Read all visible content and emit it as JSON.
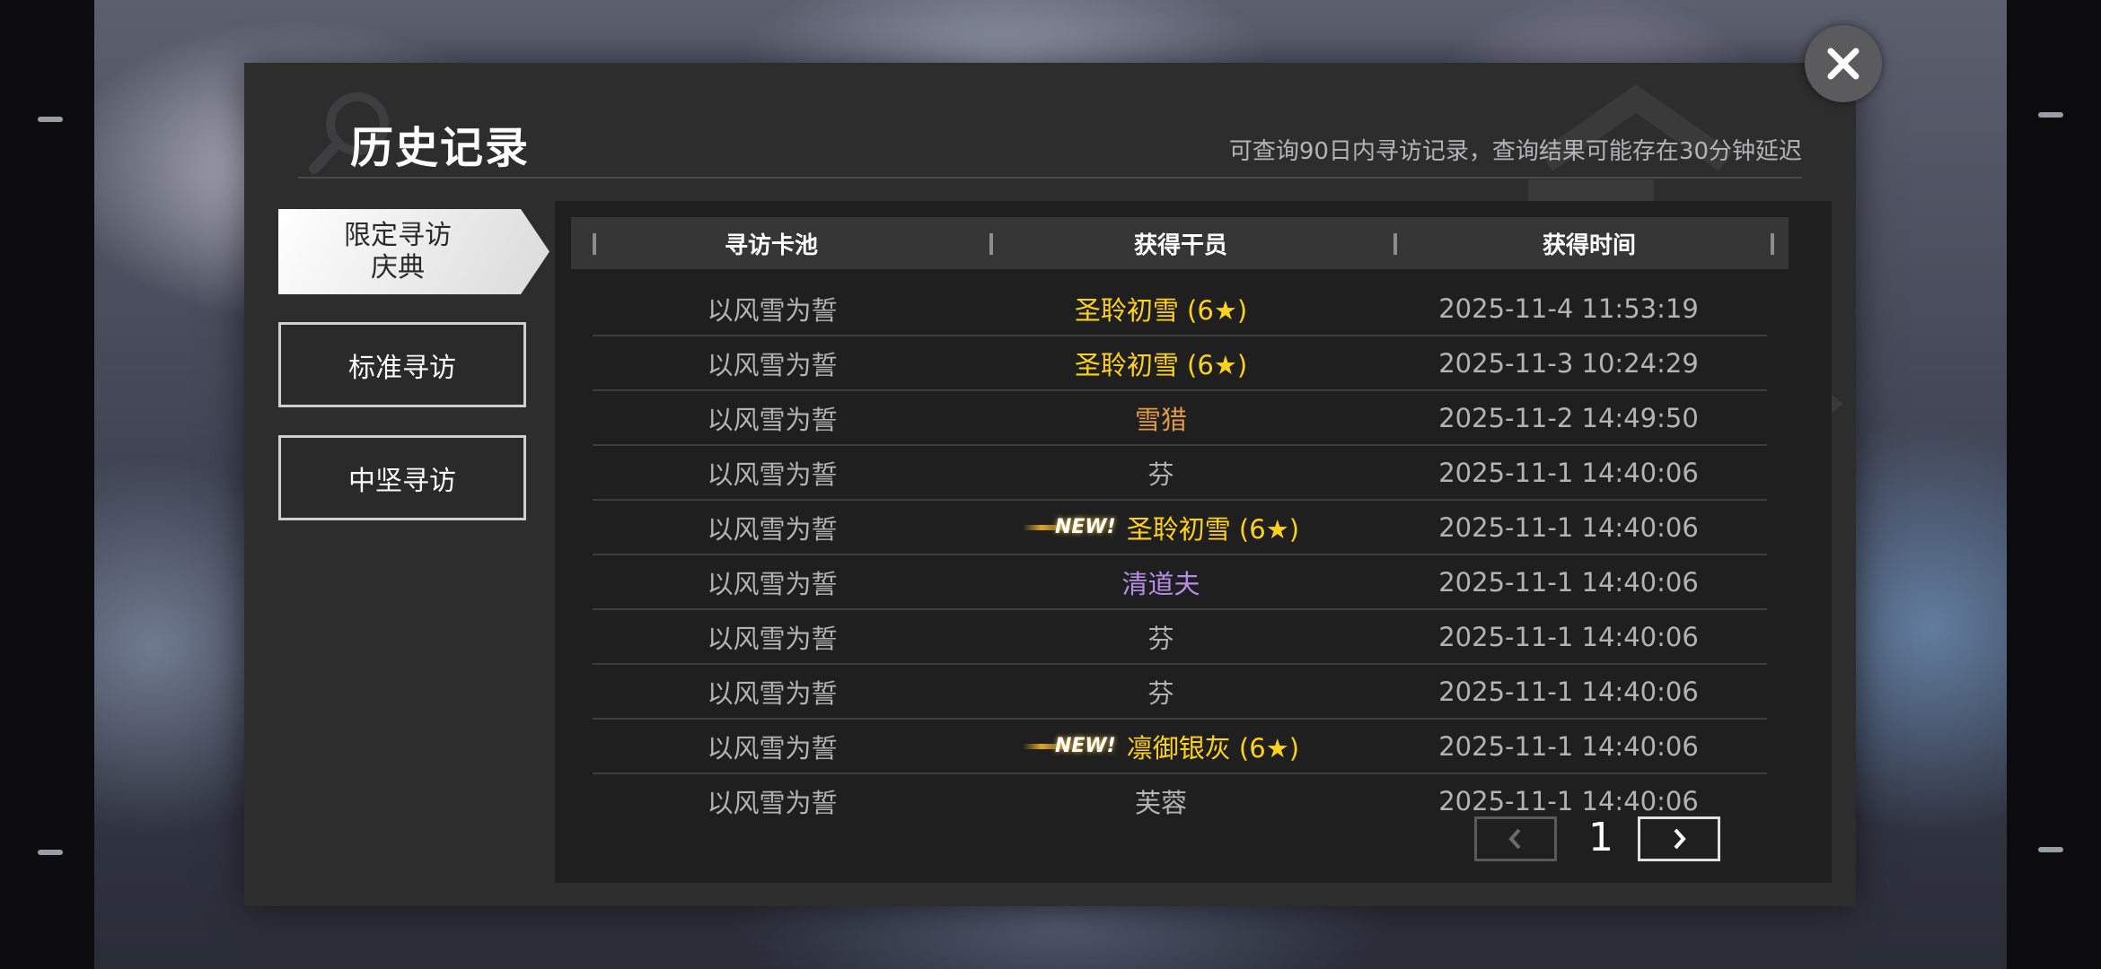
{
  "dialog": {
    "title": "历史记录",
    "subtitle": "可查询90日内寻访记录，查询结果可能存在30分钟延迟"
  },
  "tabs": [
    {
      "line1": "限定寻访",
      "line2": "庆典",
      "active": true
    },
    {
      "label": "标准寻访",
      "active": false
    },
    {
      "label": "中坚寻访",
      "active": false
    }
  ],
  "table": {
    "headers": [
      "寻访卡池",
      "获得干员",
      "获得时间"
    ],
    "rows": [
      {
        "pool": "以风雪为誓",
        "operator": "圣聆初雪 (6★)",
        "time": "2025-11-4 11:53:19",
        "new": false,
        "color": "#ffd21f"
      },
      {
        "pool": "以风雪为誓",
        "operator": "圣聆初雪 (6★)",
        "time": "2025-11-3 10:24:29",
        "new": false,
        "color": "#ffd21f"
      },
      {
        "pool": "以风雪为誓",
        "operator": "雪猎",
        "time": "2025-11-2 14:49:50",
        "new": false,
        "color": "#e39a47"
      },
      {
        "pool": "以风雪为誓",
        "operator": "芬",
        "time": "2025-11-1 14:40:06",
        "new": false,
        "color": "#b3b3b3"
      },
      {
        "pool": "以风雪为誓",
        "operator": "圣聆初雪 (6★)",
        "time": "2025-11-1 14:40:06",
        "new": true,
        "color": "#ffd21f"
      },
      {
        "pool": "以风雪为誓",
        "operator": "清道夫",
        "time": "2025-11-1 14:40:06",
        "new": false,
        "color": "#b58ce6"
      },
      {
        "pool": "以风雪为誓",
        "operator": "芬",
        "time": "2025-11-1 14:40:06",
        "new": false,
        "color": "#b3b3b3"
      },
      {
        "pool": "以风雪为誓",
        "operator": "芬",
        "time": "2025-11-1 14:40:06",
        "new": false,
        "color": "#b3b3b3"
      },
      {
        "pool": "以风雪为誓",
        "operator": "凛御银灰 (6★)",
        "time": "2025-11-1 14:40:06",
        "new": true,
        "color": "#ffd21f"
      },
      {
        "pool": "以风雪为誓",
        "operator": "芙蓉",
        "time": "2025-11-1 14:40:06",
        "new": false,
        "color": "#b3b3b3"
      }
    ],
    "new_badge": "NEW!"
  },
  "pager": {
    "current_page": "1",
    "prev_icon": "chevron-left-icon",
    "next_icon": "chevron-right-icon"
  },
  "icons": {
    "close": "close-icon",
    "decor_magnifier": "magnifier-icon"
  }
}
